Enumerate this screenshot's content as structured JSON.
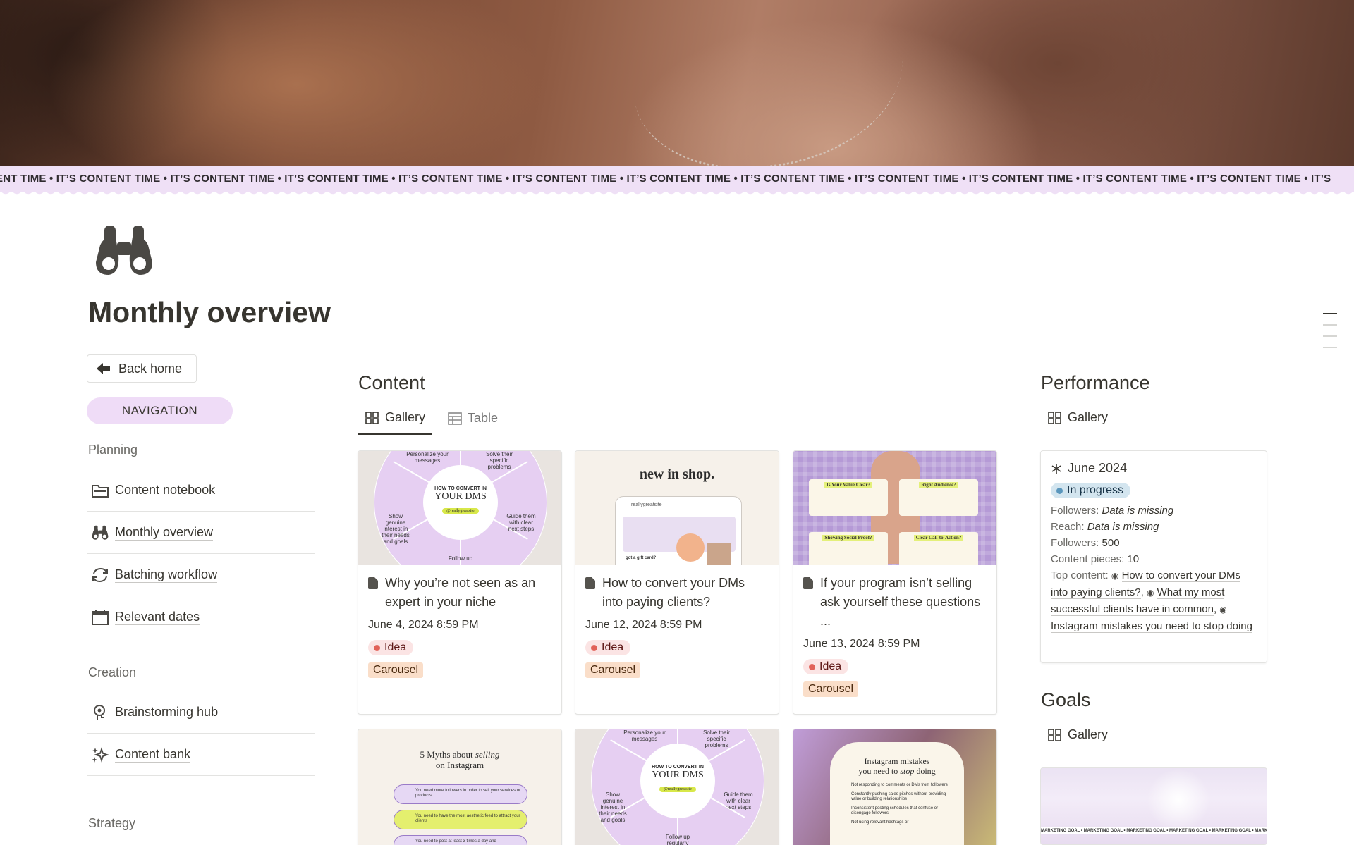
{
  "marquee": "ENT TIME • IT’S CONTENT TIME • IT’S CONTENT TIME • IT’S CONTENT TIME • IT’S CONTENT TIME • IT’S CONTENT TIME • IT’S CONTENT TIME • IT’S CONTENT TIME • IT’S CONTENT TIME • IT’S CONTENT TIME • IT’S CONTENT TIME • IT’S CONTENT TIME • IT’S",
  "page": {
    "title": "Monthly overview",
    "icon": "binoculars-icon"
  },
  "sidebar": {
    "back_label": "Back home",
    "nav_label": "NAVIGATION",
    "planning": {
      "heading": "Planning",
      "items": [
        {
          "label": "Content notebook",
          "icon": "folder-icon"
        },
        {
          "label": "Monthly overview",
          "icon": "binoculars-icon"
        },
        {
          "label": "Batching workflow",
          "icon": "refresh-icon"
        },
        {
          "label": "Relevant dates",
          "icon": "calendar-icon"
        }
      ]
    },
    "creation": {
      "heading": "Creation",
      "items": [
        {
          "label": "Brainstorming hub",
          "icon": "brain-icon"
        },
        {
          "label": "Content bank",
          "icon": "sparkles-icon"
        }
      ]
    },
    "strategy": {
      "heading": "Strategy"
    }
  },
  "content": {
    "title": "Content",
    "tabs": [
      {
        "label": "Gallery",
        "icon": "gallery-icon"
      },
      {
        "label": "Table",
        "icon": "table-icon"
      }
    ],
    "cards": [
      {
        "title": "Why you’re not seen as an expert in your niche",
        "date": "June 4, 2024 8:59 PM",
        "status": "Idea",
        "format": "Carousel",
        "thumb": {
          "small": "HOW TO CONVERT IN",
          "large": "YOUR DMS",
          "tag": "@reallygreatsite",
          "t1": "Personalize your messages",
          "t2": "Solve their specific problems",
          "t3": "Show genuine interest in their needs and goals",
          "t4": "Guide them with clear next steps",
          "t5": "Follow up"
        }
      },
      {
        "title": "How to convert your DMs into paying clients?",
        "date": "June 12, 2024 8:59 PM",
        "status": "Idea",
        "format": "Carousel",
        "thumb": {
          "headline": "new in shop.",
          "handle": "reallygreatsite",
          "caption": "got a gift card?"
        }
      },
      {
        "title": "If your program isn’t selling ask yourself these questions ...",
        "date": "June 13, 2024 8:59 PM",
        "status": "Idea",
        "format": "Carousel",
        "thumb": {
          "q1": "Is Your Value Clear?",
          "q2": "Right Audience?",
          "q3": "Showing Social Proof?",
          "q4": "Clear Call-to-Action?"
        }
      }
    ],
    "cards_row2": [
      {
        "title_line1": "5 Myths about",
        "title_em": "selling",
        "title_line2": "on Instagram",
        "items": [
          "You need more followers in order to sell your services or products",
          "You need to have the most aesthetic feed to attract your clients",
          "You need to post at least 3 times a day and"
        ]
      },
      {
        "small": "HOW TO CONVERT IN",
        "large": "YOUR DMS",
        "tag": "@reallygreatsite",
        "t1": "Personalize your messages",
        "t2": "Solve their specific problems",
        "t3": "Show genuine interest in their needs and goals",
        "t4": "Guide them with clear next steps",
        "t5": "Follow up regularly"
      },
      {
        "title_line1": "Instagram mistakes",
        "title_line2a": "you need to",
        "title_em": "stop",
        "title_line2b": "doing",
        "items": [
          "Not responding to comments or DMs from followers",
          "Constantly pushing sales pitches without providing value or building relationships",
          "Inconsistent posting schedules that confuse or disengage followers",
          "Not using relevant hashtags or"
        ]
      }
    ]
  },
  "performance": {
    "title": "Performance",
    "tab": "Gallery",
    "card": {
      "title": "June 2024",
      "status": "In progress",
      "rows": [
        {
          "label": "Followers:",
          "value": "Data is missing"
        },
        {
          "label": "Reach:",
          "value": "Data is missing"
        }
      ],
      "followers_label": "Followers:",
      "followers_value": "500",
      "pieces_label": "Content pieces:",
      "pieces_value": "10",
      "top_label": "Top content:",
      "top_links": [
        "How to convert your DMs into paying clients?",
        "What my most successful clients have in common",
        "Instagram mistakes you need to stop doing"
      ]
    }
  },
  "goals": {
    "title": "Goals",
    "tab": "Gallery",
    "strip": "MARKETING GOAL • MARKETING GOAL • MARKETING GOAL • MARKETING GOAL • MARKETING GOAL • MARKETING GOAL • MARKETING GOAL"
  }
}
